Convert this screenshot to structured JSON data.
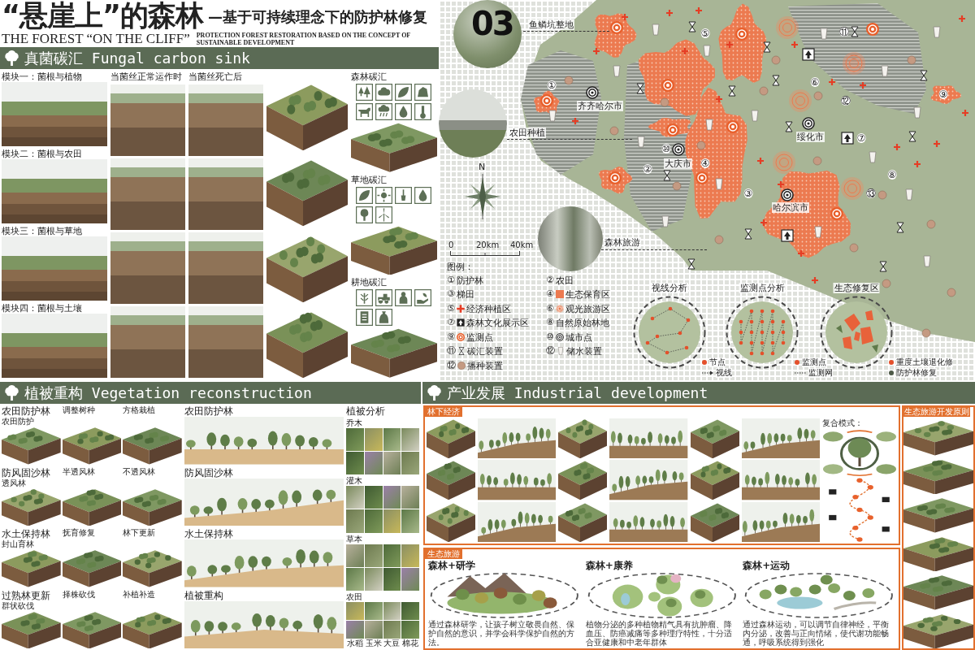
{
  "header": {
    "title": "“悬崖上”的森林",
    "subtitle": "—基于可持续理念下的防护林修复",
    "title_en": "THE FOREST “ON THE CLIFF”",
    "subtitle_en": "PROTECTION FOREST RESTORATION BASED ON THE CONCEPT OF SUSTAINABLE DEVELOPMENT",
    "sheet_number": "03"
  },
  "fungal_carbon_sink": {
    "heading": "真菌碳汇 Fungal carbon sink",
    "modules": [
      "模块一：菌根与植物",
      "模块二：菌根与农田",
      "模块三：菌根与草地",
      "模块四：菌根与土壤"
    ],
    "column_headers": [
      "当菌丝正常运作时",
      "当菌丝死亡后"
    ],
    "carbon_sinks": [
      "森林碳汇",
      "草地碳汇",
      "耕地碳汇"
    ]
  },
  "map": {
    "photo_callouts": [
      "鱼鳞坑整地",
      "农田种植",
      "森林旅游"
    ],
    "cities": [
      "齐齐哈尔市",
      "大庆市",
      "绥化市",
      "哈尔滨市"
    ],
    "zone_numbers": [
      "①",
      "②",
      "③",
      "④",
      "⑤",
      "⑥",
      "⑦",
      "⑧",
      "⑨",
      "⑩",
      "⑪",
      "⑫",
      "⑬"
    ],
    "north": "N",
    "scale": [
      "0",
      "20km",
      "40km"
    ],
    "legend_title": "图例：",
    "legend": [
      {
        "number": "①",
        "label": "防护林",
        "kind": "plain"
      },
      {
        "number": "②",
        "label": "农田",
        "kind": "plain"
      },
      {
        "number": "③",
        "label": "梯田",
        "kind": "plain"
      },
      {
        "number": "④",
        "label": "生态保育区",
        "kind": "swatch"
      },
      {
        "number": "⑤",
        "label": "经济种植区",
        "kind": "plus"
      },
      {
        "number": "⑥",
        "label": "观光旅游区",
        "kind": "rings"
      },
      {
        "number": "⑦",
        "label": "森林文化展示区",
        "kind": "sign"
      },
      {
        "number": "⑧",
        "label": "自然原始林地",
        "kind": "plain"
      },
      {
        "number": "⑨",
        "label": "监测点",
        "kind": "target"
      },
      {
        "number": "⑩",
        "label": "城市点",
        "kind": "bullseye"
      },
      {
        "number": "⑪",
        "label": "碳汇装置",
        "kind": "hourglass"
      },
      {
        "number": "⑫",
        "label": "储水装置",
        "kind": "cup"
      },
      {
        "number": "⑫",
        "label": "播种装置",
        "kind": "ball"
      }
    ],
    "analyses": [
      {
        "title": "视线分析",
        "keys": [
          {
            "label": "节点",
            "kind": "dot",
            "color": "#e4502b"
          },
          {
            "label": "视线",
            "kind": "arrow"
          }
        ]
      },
      {
        "title": "监测点分析",
        "keys": [
          {
            "label": "监测点",
            "kind": "dot",
            "color": "#e4502b"
          },
          {
            "label": "监测网",
            "kind": "line"
          }
        ]
      },
      {
        "title": "生态修复区",
        "keys": [
          {
            "label": "重度土壤退化修",
            "kind": "dot",
            "color": "#e4502b"
          },
          {
            "label": "防护林修复",
            "kind": "dot",
            "color": "#4e5a48"
          }
        ]
      }
    ]
  },
  "vegetation_reconstruction": {
    "heading": "植被重构 Vegetation reconstruction",
    "patterns": [
      {
        "title": "农田防护林",
        "options": [
          "农田防护",
          "调整树种",
          "方格栽植"
        ]
      },
      {
        "title": "防风固沙林",
        "options": [
          "透风林",
          "半透风林",
          "不透风林"
        ]
      },
      {
        "title": "水土保持林",
        "options": [
          "封山育林",
          "抚育修复",
          "林下更新"
        ]
      },
      {
        "title": "过熟林更新",
        "options": [
          "群状砍伐",
          "择株砍伐",
          "补植补造"
        ]
      }
    ],
    "sections": [
      "农田防护林",
      "防风固沙林",
      "水土保持林",
      "植被重构"
    ],
    "analysis": {
      "title": "植被分析",
      "groups": [
        {
          "label": "乔木"
        },
        {
          "label": "灌木"
        },
        {
          "label": "草本"
        },
        {
          "label": "农田",
          "captions": [
            "水稻",
            "玉米",
            "大豆",
            "棉花"
          ]
        }
      ]
    }
  },
  "industrial_development": {
    "heading": "产业发展 Industrial development",
    "understory_economy": {
      "tag": "林下经济",
      "composite_label": "复合模式："
    },
    "ecotourism": {
      "tag": "生态旅游",
      "panels": [
        {
          "title": "森林+研学",
          "description": "通过森林研学，让孩子树立敬畏自然、保护自然的意识，并学会科学保护自然的方法。"
        },
        {
          "title": "森林+康养",
          "description": "植物分泌的多种植物精气具有抗肿瘤、降血压、防癌减痛等多种理疗特性，十分适合亚健康和中老年群体"
        },
        {
          "title": "森林+运动",
          "description": "通过森林运动，可以调节自律神经，平衡内分泌，改善与正向情绪，使代谢功能畅通，呼吸系统得到强化"
        }
      ]
    },
    "principles": {
      "tag": "生态旅游开发原则"
    }
  }
}
